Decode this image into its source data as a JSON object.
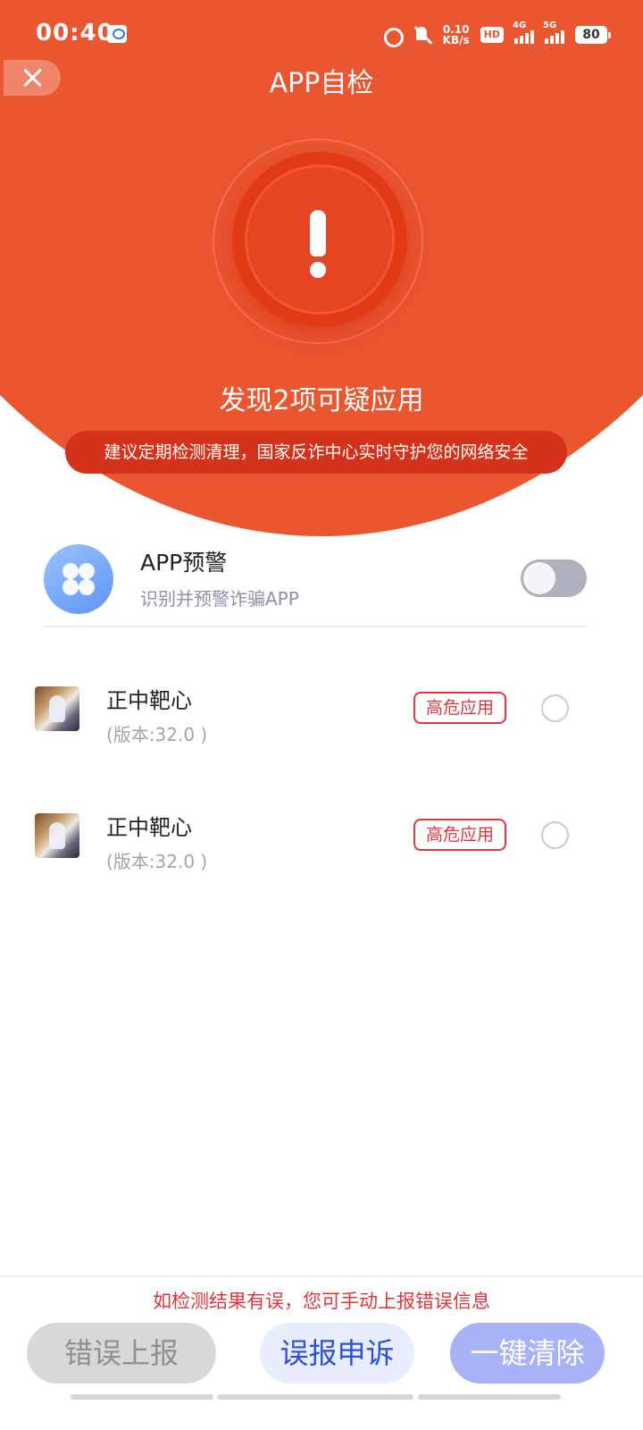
{
  "status_bar": {
    "time": "00:40",
    "net_speed_value": "0.10",
    "net_speed_unit": "KB/s",
    "hd_label": "HD",
    "signal_4g_label": "4G",
    "signal_5g_label": "5G",
    "battery_level": "80",
    "icons": [
      "app-notification-icon",
      "alarm-icon",
      "mute-icon",
      "hd-icon",
      "signal-4g-icon",
      "signal-5g-icon",
      "battery-icon"
    ]
  },
  "header": {
    "title": "APP自检",
    "close_icon": "close-icon",
    "accent_color": "#ea5630"
  },
  "scan_result": {
    "warning_icon": "exclamation-icon",
    "summary": "发现2项可疑应用",
    "advice": "建议定期检测清理，国家反诈中心实时守护您的网络安全"
  },
  "app_warning": {
    "icon": "app-grid-icon",
    "title": "APP预警",
    "subtitle": "识别并预警诈骗APP",
    "toggle_on": false
  },
  "apps": [
    {
      "name": "正中靶心",
      "version": "(版本:32.0 )",
      "badge": "高危应用",
      "selected": false
    },
    {
      "name": "正中靶心",
      "version": "(版本:32.0 )",
      "badge": "高危应用",
      "selected": false
    }
  ],
  "footer": {
    "hint": "如检测结果有误，您可手动上报错误信息",
    "report_label": "错误上报",
    "appeal_label": "误报申诉",
    "clear_label": "一键清除",
    "danger_color": "#e0353a"
  }
}
